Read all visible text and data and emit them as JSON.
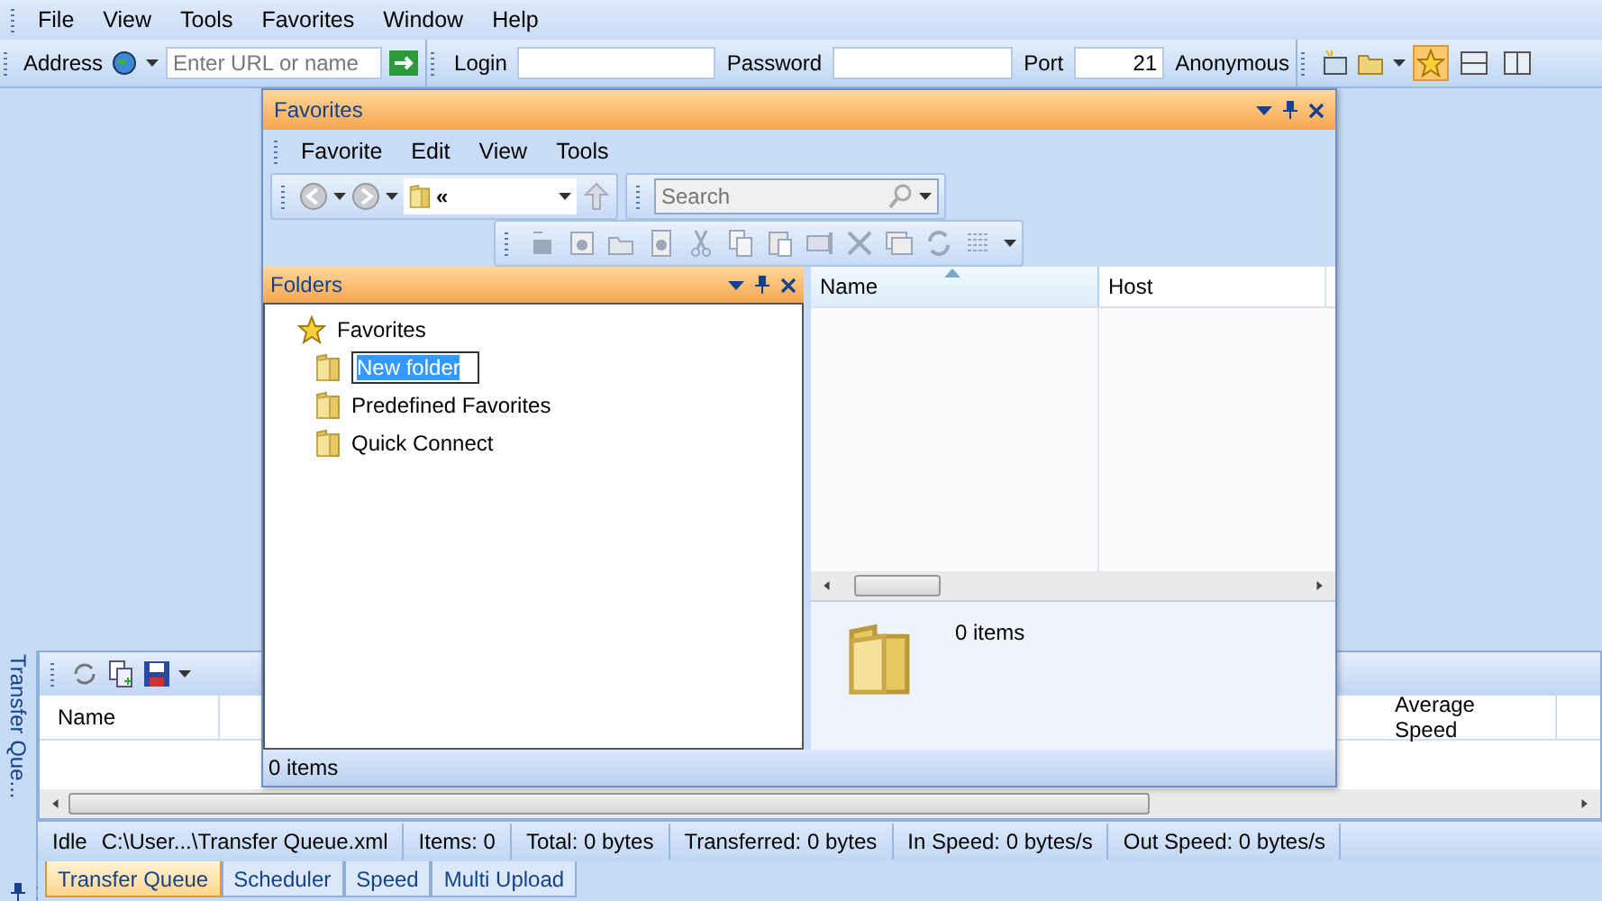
{
  "menu": [
    "File",
    "View",
    "Tools",
    "Favorites",
    "Window",
    "Help"
  ],
  "address_bar": {
    "label": "Address",
    "placeholder": "Enter URL or name"
  },
  "login_bar": {
    "login_label": "Login",
    "password_label": "Password",
    "port_label": "Port",
    "port": "21",
    "anonymous_label": "Anonymous"
  },
  "view_buttons": [
    {
      "selected": true
    },
    {
      "selected": false
    },
    {
      "selected": false
    }
  ],
  "favorites_window": {
    "title": "Favorites",
    "menu": [
      "Favorite",
      "Edit",
      "View",
      "Tools"
    ],
    "path": "«",
    "search": {
      "placeholder": "Search"
    },
    "folders_pane": {
      "title": "Folders",
      "tree": [
        {
          "label": "Favorites",
          "kind": "star",
          "editing": false,
          "children": [
            {
              "label": "New folder",
              "kind": "folder",
              "editing": true
            },
            {
              "label": "Predefined Favorites",
              "kind": "folder",
              "editing": false
            },
            {
              "label": "Quick Connect",
              "kind": "folder",
              "editing": false
            }
          ]
        }
      ]
    },
    "list": {
      "columns": [
        {
          "label": "Name",
          "sorted": true
        },
        {
          "label": "Host",
          "sorted": false
        }
      ]
    },
    "details": "0 items",
    "status": "0 items"
  },
  "side_tab": "Transfer Que...",
  "queue": {
    "columns": [
      "Name",
      "Average Speed"
    ]
  },
  "status_bar": [
    "Idle",
    "C:\\User...\\Transfer Queue.xml",
    "Items: 0",
    "Total: 0 bytes",
    "Transferred: 0 bytes",
    "In Speed: 0 bytes/s",
    "Out Speed: 0 bytes/s"
  ],
  "tabs": [
    {
      "label": "Transfer Queue",
      "selected": true
    },
    {
      "label": "Scheduler",
      "selected": false
    },
    {
      "label": "Speed",
      "selected": false
    },
    {
      "label": "Multi Upload",
      "selected": false
    }
  ]
}
